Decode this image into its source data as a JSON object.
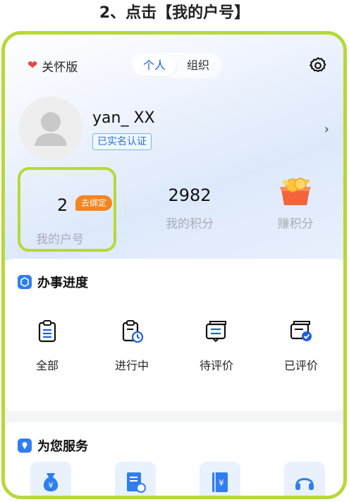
{
  "caption": "2、点击【我的户号】",
  "topbar": {
    "care_label": "关怀版",
    "tabs": [
      "个人",
      "组织"
    ],
    "active_tab": "个人"
  },
  "profile": {
    "username": "yan_ XX",
    "verify_badge": "已实名认证"
  },
  "stats": {
    "account_count": "2",
    "account_badge": "去绑定",
    "account_label": "我的户号",
    "points_value": "2982",
    "points_label": "我的积分",
    "earn_label": "赚积分"
  },
  "progress": {
    "title": "办事进度",
    "items": [
      {
        "label": "全部",
        "icon": "clipboard-list-icon"
      },
      {
        "label": "进行中",
        "icon": "clipboard-clock-icon"
      },
      {
        "label": "待评价",
        "icon": "chat-document-icon"
      },
      {
        "label": "已评价",
        "icon": "chat-check-icon"
      }
    ]
  },
  "services": {
    "title": "为您服务",
    "icons": [
      "money-bag-icon",
      "bill-clock-icon",
      "yuan-book-icon",
      "headset-icon"
    ]
  },
  "colors": {
    "accent_blue": "#1e5fd8",
    "highlight_green": "#b7d93a",
    "badge_orange": "#f6841f"
  }
}
